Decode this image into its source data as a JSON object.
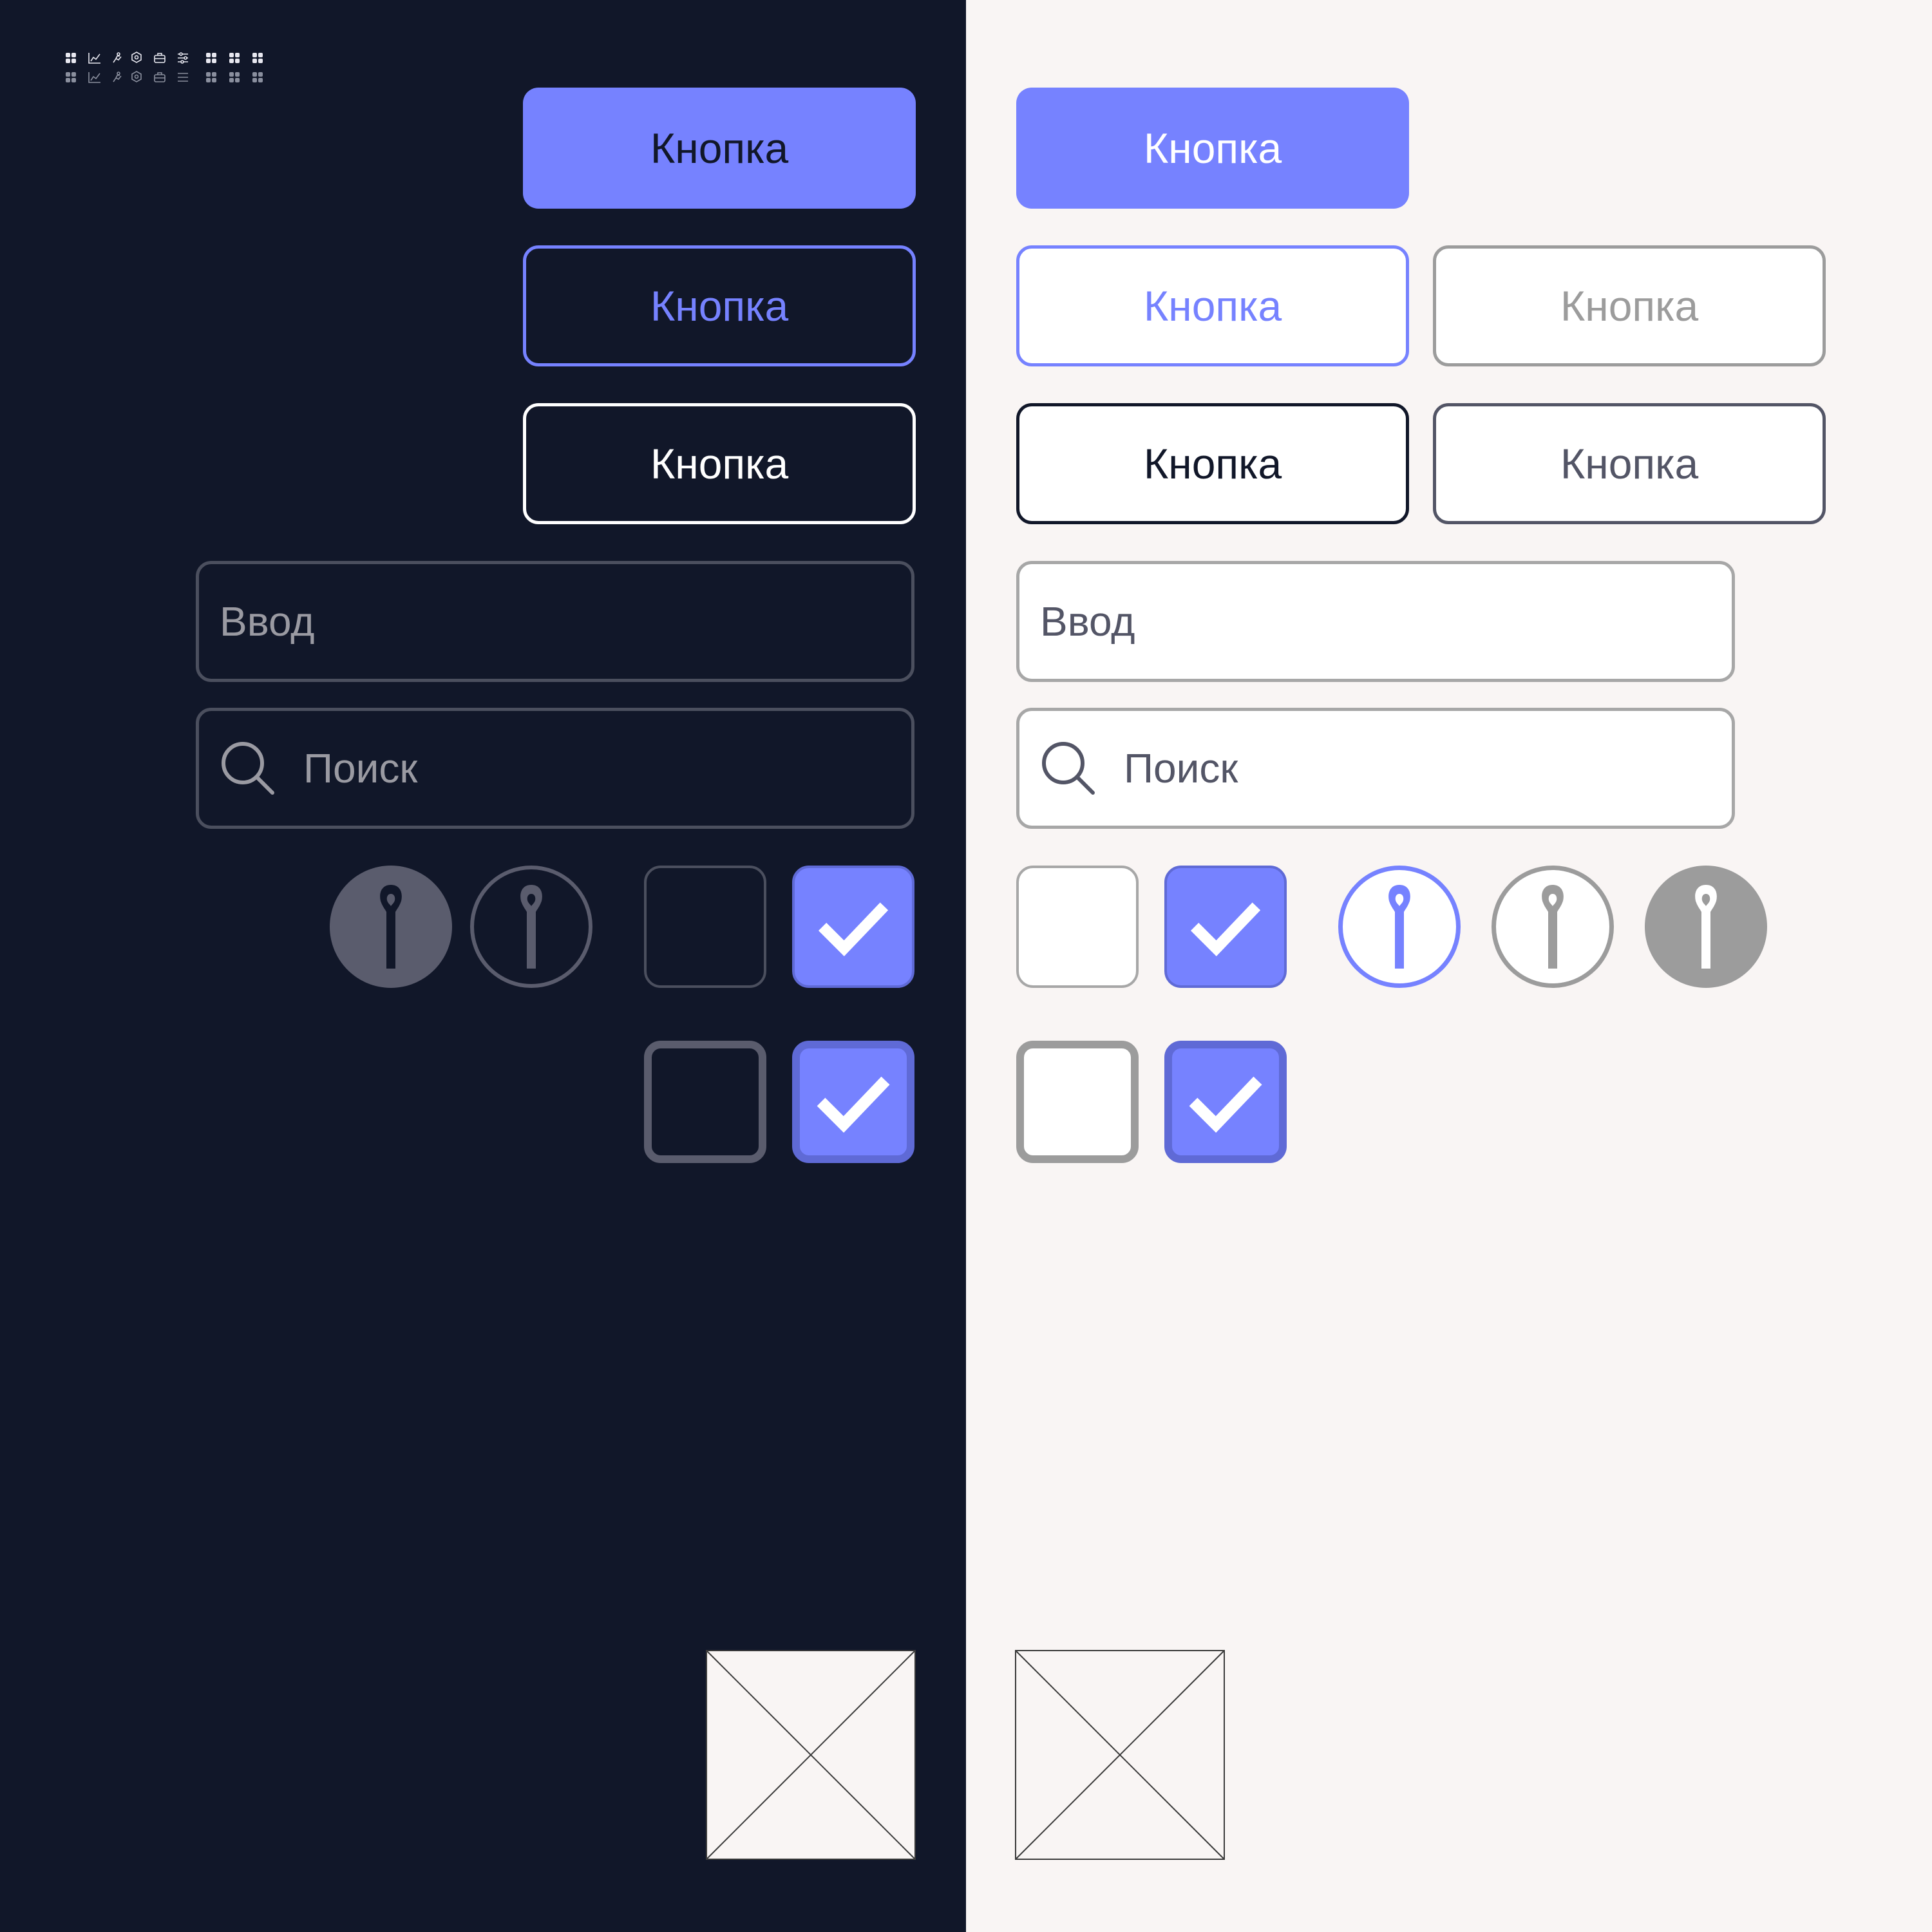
{
  "theme": {
    "accent": "#7682ff",
    "accent_dark": "#5f6ad6",
    "dark_bg": "#111729",
    "light_bg": "#f9f5f4",
    "neutral_gray": "#9c9c9c",
    "slate": "#535566"
  },
  "top_icons": [
    "grid-icon",
    "chart-icon",
    "run-icon",
    "hexagon-icon",
    "briefcase-icon",
    "sliders-icon",
    "grid-icon",
    "grid-icon",
    "grid-icon"
  ],
  "dark": {
    "button_primary": "Кнопка",
    "button_outline_accent": "Кнопка",
    "button_outline_white": "Кнопка",
    "input_placeholder": "Ввод",
    "search_placeholder": "Поиск"
  },
  "light": {
    "button_primary": "Кнопка",
    "button_outline_accent": "Кнопка",
    "button_outline_gray": "Кнопка",
    "button_outline_dark": "Кнопка",
    "button_outline_slate": "Кнопка",
    "input_placeholder": "Ввод",
    "search_placeholder": "Поиск"
  }
}
